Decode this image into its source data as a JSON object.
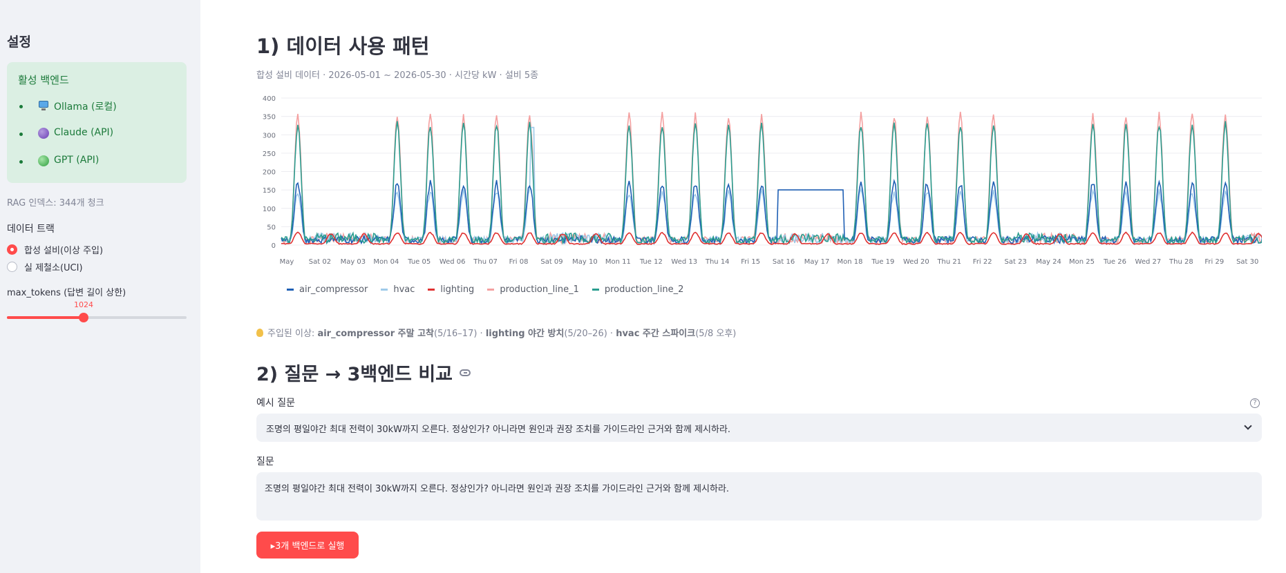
{
  "sidebar": {
    "title": "설정",
    "backend_box": {
      "title": "활성 백엔드",
      "items": [
        {
          "label": "Ollama (로컬)",
          "icon": "monitor-icon"
        },
        {
          "label": "Claude (API)",
          "icon": "purple-circle-icon"
        },
        {
          "label": "GPT (API)",
          "icon": "green-circle-icon"
        }
      ]
    },
    "rag_caption": "RAG 인덱스: 344개 청크",
    "track": {
      "label": "데이터 트랙",
      "options": [
        "합성 설비(이상 주입)",
        "실 제철소(UCI)"
      ],
      "selected": 0
    },
    "max_tokens": {
      "label": "max_tokens (답변 길이 상한)",
      "value": "1024",
      "min": 0,
      "max": 2400,
      "fraction": 0.427
    }
  },
  "section1": {
    "title": "1) 데이터 사용 패턴",
    "caption": "합성 설비 데이터 · 2026-05-01 ~ 2026-05-30 · 시간당 kW · 설비 5종",
    "anomaly_note": {
      "prefix": "주입된 이상: ",
      "a1": "air_compressor 주말 고착",
      "a1d": "(5/16–17) · ",
      "a2": "lighting 야간 방치",
      "a2d": "(5/20–26) · ",
      "a3": "hvac 주간 스파이크",
      "a3d": "(5/8 오후)"
    }
  },
  "chart_data": {
    "type": "line",
    "title": "",
    "xlabel": "",
    "ylabel": "",
    "ylim": [
      0,
      400
    ],
    "yticks": [
      0,
      50,
      100,
      150,
      200,
      250,
      300,
      350,
      400
    ],
    "xticks": [
      "May",
      "Sat 02",
      "May 03",
      "Mon 04",
      "Tue 05",
      "Wed 06",
      "Thu 07",
      "Fri 08",
      "Sat 09",
      "May 10",
      "Mon 11",
      "Tue 12",
      "Wed 13",
      "Thu 14",
      "Fri 15",
      "Sat 16",
      "May 17",
      "Mon 18",
      "Tue 19",
      "Wed 20",
      "Thu 21",
      "Fri 22",
      "Sat 23",
      "May 24",
      "Mon 25",
      "Tue 26",
      "Wed 27",
      "Thu 28",
      "Fri 29",
      "Sat 30"
    ],
    "x_range": [
      "2026-05-01",
      "2026-05-30"
    ],
    "resolution": "hourly",
    "weekend_days": [
      "2026-05-02",
      "2026-05-03",
      "2026-05-09",
      "2026-05-10",
      "2026-05-16",
      "2026-05-17",
      "2026-05-23",
      "2026-05-24",
      "2026-05-30"
    ],
    "legend_position": "bottom",
    "series": [
      {
        "name": "air_compressor",
        "color": "#1f5fb4",
        "weekday_peak": 160,
        "weekend_level": 15,
        "stuck_value": 150,
        "stuck_period": [
          "2026-05-16",
          "2026-05-17"
        ]
      },
      {
        "name": "hvac",
        "color": "#9ecae9",
        "weekday_peak": 135,
        "weekend_level": 20,
        "spike_value": 320,
        "spike_date": "2026-05-08"
      },
      {
        "name": "lighting",
        "color": "#e03131",
        "weekday_peak": 30,
        "weekend_level": 30
      },
      {
        "name": "production_line_1",
        "color": "#f4a0a0",
        "weekday_peak": 345,
        "weekend_level": 20
      },
      {
        "name": "production_line_2",
        "color": "#2a9d8f",
        "weekday_peak": 320,
        "weekend_level": 20
      }
    ]
  },
  "section2": {
    "title": "2) 질문 → 3백엔드 비교",
    "example_label": "예시 질문",
    "example_value": "조명의 평일야간 최대 전력이 30kW까지 오른다. 정상인가? 아니라면 원인과 권장 조치를 가이드라인 근거와 함께 제시하라.",
    "question_label": "질문",
    "question_value": "조명의 평일야간 최대 전력이 30kW까지 오른다. 정상인가? 아니라면 원인과 권장 조치를 가이드라인 근거와 함께 제시하라.",
    "run_button": "▸3개 백엔드로 실행",
    "help_glyph": "?"
  }
}
